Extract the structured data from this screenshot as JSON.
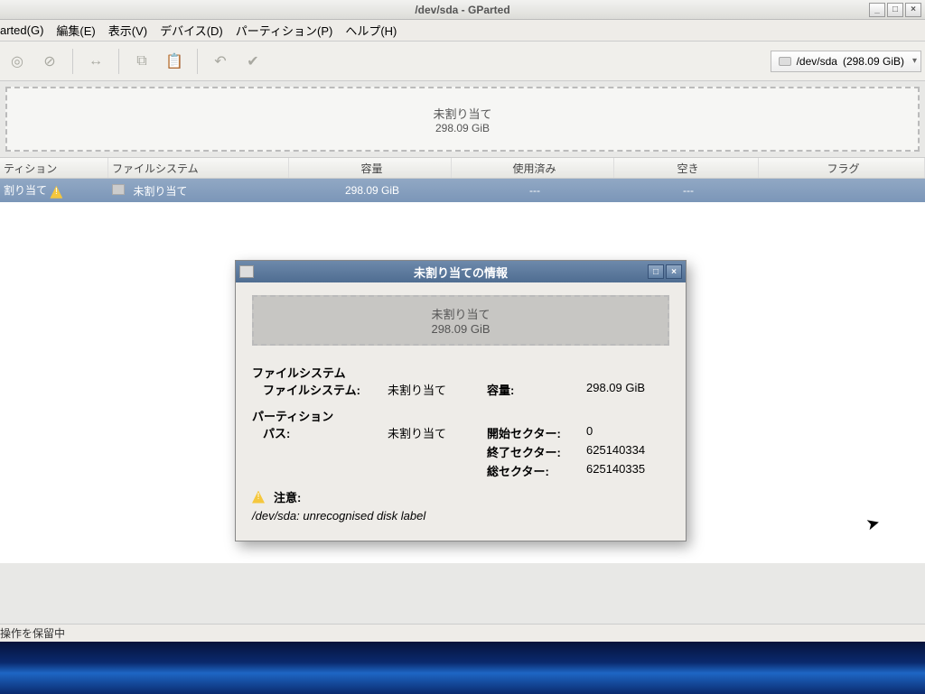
{
  "window": {
    "title": "/dev/sda - GParted"
  },
  "menu": {
    "gparted": "arted(G)",
    "edit": "編集(E)",
    "view": "表示(V)",
    "device": "デバイス(D)",
    "partition": "パーティション(P)",
    "help": "ヘルプ(H)"
  },
  "device_selector": {
    "device": "/dev/sda",
    "size": "(298.09 GiB)"
  },
  "graphic": {
    "label": "未割り当て",
    "size": "298.09 GiB"
  },
  "columns": {
    "partition": "ティション",
    "fs": "ファイルシステム",
    "size": "容量",
    "used": "使用済み",
    "free": "空き",
    "flags": "フラグ"
  },
  "row": {
    "partition": "割り当て",
    "fs": "未割り当て",
    "size": "298.09 GiB",
    "used": "---",
    "free": "---",
    "flags": ""
  },
  "status": "操作を保留中",
  "dialog": {
    "title": "未割り当ての情報",
    "graphic_label": "未割り当て",
    "graphic_size": "298.09 GiB",
    "fs_heading": "ファイルシステム",
    "fs_label": "ファイルシステム:",
    "fs_value": "未割り当て",
    "cap_label": "容量:",
    "cap_value": "298.09 GiB",
    "part_heading": "パーティション",
    "path_label": "パス:",
    "path_value": "未割り当て",
    "start_label": "開始セクター:",
    "start_value": "0",
    "end_label": "終了セクター:",
    "end_value": "625140334",
    "total_label": "総セクター:",
    "total_value": "625140335",
    "warn_heading": "注意:",
    "warn_msg": "/dev/sda: unrecognised disk label"
  }
}
